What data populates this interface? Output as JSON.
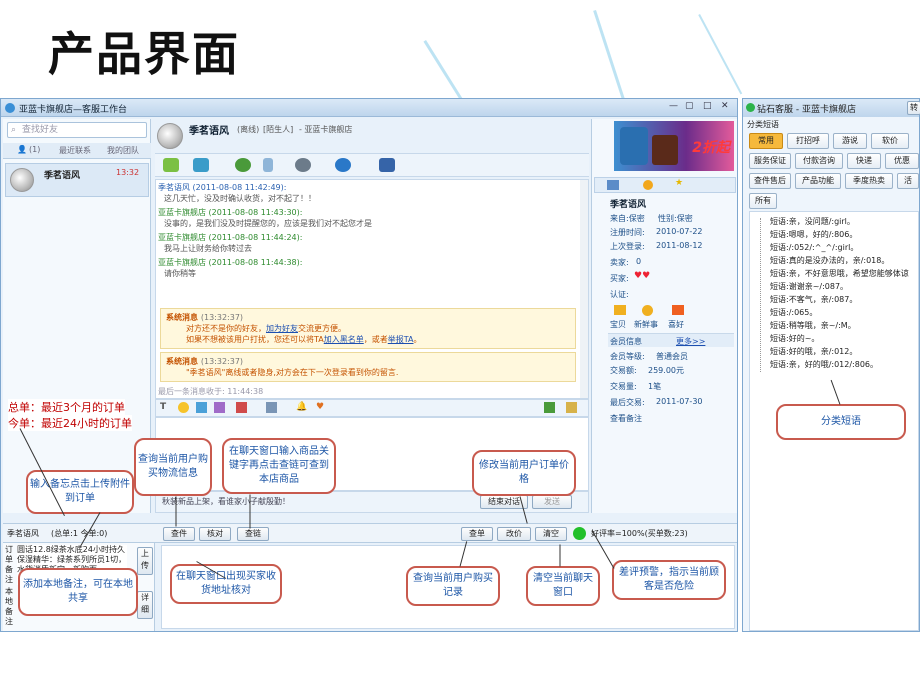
{
  "slide": {
    "title": "产品界面"
  },
  "main_window": {
    "title": "亚蓝卡旗舰店—客服工作台",
    "search_placeholder": "查找好友",
    "tabs": [
      "(1)",
      "最近联系",
      "我的团队"
    ],
    "contact": {
      "name": "季茗语风",
      "time": "13:32"
    },
    "chat_header": {
      "name": "季茗语风",
      "status": "(离线)",
      "tag": "[陌生人]",
      "shop": "- 亚蓝卡旗舰店"
    },
    "messages": [
      {
        "header": "季茗语风 (2011-08-08 11:42:49):",
        "body": "这几天忙，没及时确认收货，对不起了！！",
        "color": "blue"
      },
      {
        "header": "亚蓝卡旗舰店 (2011-08-08 11:43:30):",
        "body": "没事的，是我们没及时提醒您的，应该是我们对不起您才是",
        "color": "green"
      },
      {
        "header": "亚蓝卡旗舰店 (2011-08-08 11:44:24):",
        "body": "我马上让财务给你转过去",
        "color": "green"
      },
      {
        "header": "亚蓝卡旗舰店 (2011-08-08 11:44:38):",
        "body": "请你稍等",
        "color": "green"
      }
    ],
    "system_messages": [
      {
        "title": "系统消息",
        "time": "(13:32:37)",
        "line1_pre": "对方还不是你的好友，",
        "line1_link": "加为好友",
        "line1_post": "交流更方便。",
        "line2_pre": "如果不想被该用户打扰，您还可以将TA",
        "line2_link1": "加入黑名单",
        "line2_mid": "，或者",
        "line2_link2": "举报TA",
        "line2_post": "。"
      },
      {
        "title": "系统消息",
        "time": "(13:32:37)",
        "line1": "\"季茗语风\"离线或者隐身,对方会在下一次登录看到你的留言."
      }
    ],
    "last_msg_note": "最后一条消息收于: 11:44:38",
    "input_hint": "秋装新品上架，看谁家小子献殷勤！",
    "close_button": "结束对话",
    "send_button": "发送",
    "customer": {
      "name": "季茗语风",
      "from": "来自:保密",
      "gender": "性别:保密",
      "register_label": "注册时间:",
      "register": "2010-07-22",
      "lastlogin_label": "上次登录:",
      "lastlogin": "2011-08-12",
      "seller_label": "卖家:",
      "seller": "0",
      "buyer_label": "买家:",
      "auth_label": "认证:",
      "shortcuts": [
        "宝贝",
        "新鲜事",
        "喜好"
      ],
      "member_info": "会员信息",
      "more": "更多>>",
      "level_label": "会员等级:",
      "level": "普通会员",
      "amount_label": "交易额:",
      "amount": "259.00元",
      "count_label": "交易量:",
      "count": "1笔",
      "last_trade_label": "最后交易:",
      "last_trade": "2011-07-30",
      "notes": "查看备注"
    },
    "banner_text": "2折起",
    "order_bar": {
      "name": "季茗语风",
      "counts": "(总单:1 今单:0)",
      "buttons": [
        "查件",
        "核对",
        "查链"
      ],
      "right_buttons": [
        "查单",
        "改价",
        "清空"
      ],
      "rating": "好评率=100%(买单数:23)"
    },
    "order_left": {
      "side_label": "订单备注",
      "side_label2": "本地备注",
      "text": "圆话12.8绿茶水底24小时持久保湿精华：绿茶系列所员1切，水货消质新定，新吹面",
      "up_button": "上传",
      "detail_button": "详细"
    }
  },
  "right_window": {
    "title": "钻石客服 - 亚蓝卡旗舰店",
    "top_btn": "转",
    "section": "分类短语",
    "categories": [
      [
        "常用",
        "打招呼",
        "游说",
        "软价"
      ],
      [
        "服务保证",
        "付款咨询",
        "快递",
        "优惠"
      ],
      [
        "查件售后",
        "产品功能",
        "季度热卖",
        "活"
      ],
      [
        "所有"
      ]
    ],
    "phrases": [
      "短语:亲，没问题/:girl。",
      "短语:嗯嗯，好的/:806。",
      "短语:/:052/:^_^/:girl。",
      "短语:真的是没办法的，亲/:018。",
      "短语:亲，不好意思哦，希望您能够体谅",
      "短语:谢谢亲~/:087。",
      "短语:不客气，亲/:087。",
      "短语:/:065。",
      "短语:稍等哦，亲~/:M。",
      "短语:好的~。",
      "短语:好的哦，亲/:012。",
      "短语:亲，好的哦/:012/:806。"
    ]
  },
  "annotations": {
    "total": "总单：最近3个月的订单",
    "today": "今单：最近24小时的订单",
    "c1": "输入备忘点击上传附件到订单",
    "c2": "查询当前用户购买物流信息",
    "c3": "在聊天窗口输入商品关键字再点击查链可查到本店商品",
    "c4": "修改当前用户订单价格",
    "c5": "添加本地备注，可在本地共享",
    "c6": "在聊天窗口出现买家收货地址核对",
    "c7": "查询当前用户购买记录",
    "c8": "清空当前聊天窗口",
    "c9": "差评预警，指示当前顾客是否危险",
    "c10": "分类短语"
  },
  "colors": {
    "accent": "#7ea7cf",
    "callout_border": "#c85a4e",
    "callout_text": "#1d56a6",
    "selected_tab": "#f6b93c"
  }
}
